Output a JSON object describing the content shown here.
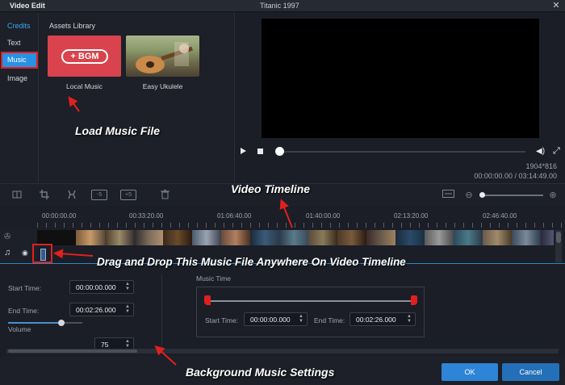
{
  "window": {
    "app_title": "Video Edit",
    "file_title": "Titanic 1997",
    "close_glyph": "✕"
  },
  "categories": [
    {
      "label": "Credits",
      "state": "highlight"
    },
    {
      "label": "Text"
    },
    {
      "label": "Music",
      "selected": true
    },
    {
      "label": "Image"
    }
  ],
  "assets": {
    "title": "Assets Library",
    "items": [
      {
        "label": "Local Music",
        "badge": "+ BGM",
        "color": "#d9434e"
      },
      {
        "label": "Easy Ukulele"
      }
    ]
  },
  "player": {
    "resolution": "1904*816",
    "time": "00:00:00.00 / 03:14:49.00"
  },
  "toolbar": {
    "icons": [
      "split-icon",
      "crop-icon",
      "effect-icon",
      "rewind-5-icon",
      "forward-5-icon",
      "delete-icon",
      "fit-icon",
      "zoom-out-icon",
      "zoom-in-icon"
    ],
    "rewind_label": "-5",
    "forward_label": "+5"
  },
  "timeline": {
    "ticks": [
      "00:00:00.00",
      "00:33:20.00",
      "01:06:40.00",
      "01:40:00.00",
      "02:13:20.00",
      "02:46:40.00"
    ]
  },
  "settings": {
    "start_time_label": "Start Time:",
    "start_time_value": "00:00:00.000",
    "end_time_label": "End Time:",
    "end_time_value": "00:02:26.000",
    "volume_label": "Volume",
    "volume_value": "75",
    "volume_level": 0.75,
    "music_time_label": "Music Time",
    "music_start_label": "Start Time:",
    "music_start_value": "00:00:00.000",
    "music_end_label": "End Time:",
    "music_end_value": "00:02:26.000"
  },
  "buttons": {
    "ok": "OK",
    "cancel": "Cancel"
  },
  "annotations": {
    "load_music": "Load Music File",
    "video_timeline": "Video Timeline",
    "drag_drop": "Drag and Drop This Music File Anywhere On Video Timeline",
    "bg_settings": "Background Music Settings"
  },
  "colors": {
    "accent": "#2891e4",
    "highlight_box": "#e02020",
    "bgm_tile": "#d9434e"
  }
}
